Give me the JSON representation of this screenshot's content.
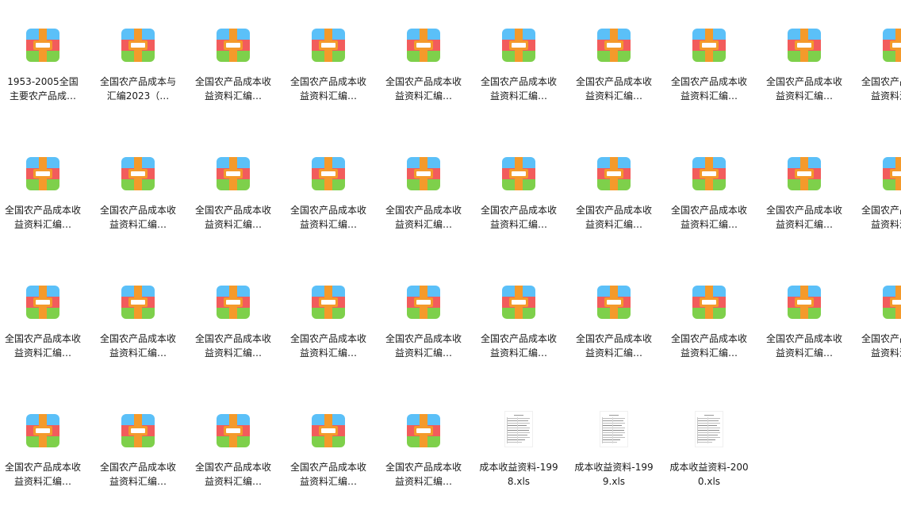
{
  "files": [
    {
      "label": "1953-2005全国主要农产品成…",
      "type": "archive"
    },
    {
      "label": "全国农产品成本与汇编2023（…",
      "type": "archive"
    },
    {
      "label": "全国农产品成本收益资料汇编…",
      "type": "archive"
    },
    {
      "label": "全国农产品成本收益资料汇编…",
      "type": "archive"
    },
    {
      "label": "全国农产品成本收益资料汇编…",
      "type": "archive"
    },
    {
      "label": "全国农产品成本收益资料汇编…",
      "type": "archive"
    },
    {
      "label": "全国农产品成本收益资料汇编…",
      "type": "archive"
    },
    {
      "label": "全国农产品成本收益资料汇编…",
      "type": "archive"
    },
    {
      "label": "全国农产品成本收益资料汇编…",
      "type": "archive"
    },
    {
      "label": "全国农产品成本收益资料汇编…",
      "type": "archive"
    },
    {
      "label": "全国农产品成本收益资料汇编…",
      "type": "archive"
    },
    {
      "label": "全国农产品成本收益资料汇编…",
      "type": "archive"
    },
    {
      "label": "全国农产品成本收益资料汇编…",
      "type": "archive"
    },
    {
      "label": "全国农产品成本收益资料汇编…",
      "type": "archive"
    },
    {
      "label": "全国农产品成本收益资料汇编…",
      "type": "archive"
    },
    {
      "label": "全国农产品成本收益资料汇编…",
      "type": "archive"
    },
    {
      "label": "全国农产品成本收益资料汇编…",
      "type": "archive"
    },
    {
      "label": "全国农产品成本收益资料汇编…",
      "type": "archive"
    },
    {
      "label": "全国农产品成本收益资料汇编…",
      "type": "archive"
    },
    {
      "label": "全国农产品成本收益资料汇编…",
      "type": "archive"
    },
    {
      "label": "全国农产品成本收益资料汇编…",
      "type": "archive"
    },
    {
      "label": "全国农产品成本收益资料汇编…",
      "type": "archive"
    },
    {
      "label": "全国农产品成本收益资料汇编…",
      "type": "archive"
    },
    {
      "label": "全国农产品成本收益资料汇编…",
      "type": "archive"
    },
    {
      "label": "全国农产品成本收益资料汇编…",
      "type": "archive"
    },
    {
      "label": "全国农产品成本收益资料汇编…",
      "type": "archive"
    },
    {
      "label": "全国农产品成本收益资料汇编…",
      "type": "archive"
    },
    {
      "label": "全国农产品成本收益资料汇编…",
      "type": "archive"
    },
    {
      "label": "全国农产品成本收益资料汇编…",
      "type": "archive"
    },
    {
      "label": "全国农产品成本收益资料汇编…",
      "type": "archive"
    },
    {
      "label": "全国农产品成本收益资料汇编…",
      "type": "archive"
    },
    {
      "label": "全国农产品成本收益资料汇编…",
      "type": "archive"
    },
    {
      "label": "全国农产品成本收益资料汇编…",
      "type": "archive"
    },
    {
      "label": "全国农产品成本收益资料汇编…",
      "type": "archive"
    },
    {
      "label": "全国农产品成本收益资料汇编…",
      "type": "archive"
    },
    {
      "label": "成本收益资料-1998.xls",
      "type": "xls"
    },
    {
      "label": "成本收益资料-1999.xls",
      "type": "xls"
    },
    {
      "label": "成本收益资料-2000.xls",
      "type": "xls"
    }
  ],
  "icons": {
    "archive": "archive-file-icon",
    "xls": "spreadsheet-file-icon"
  },
  "colors": {
    "archive_top": "#5bc0f8",
    "archive_middle": "#f25c5c",
    "archive_bottom": "#7ed04b",
    "archive_strap": "#f49a2b",
    "archive_label": "#ffffff"
  }
}
